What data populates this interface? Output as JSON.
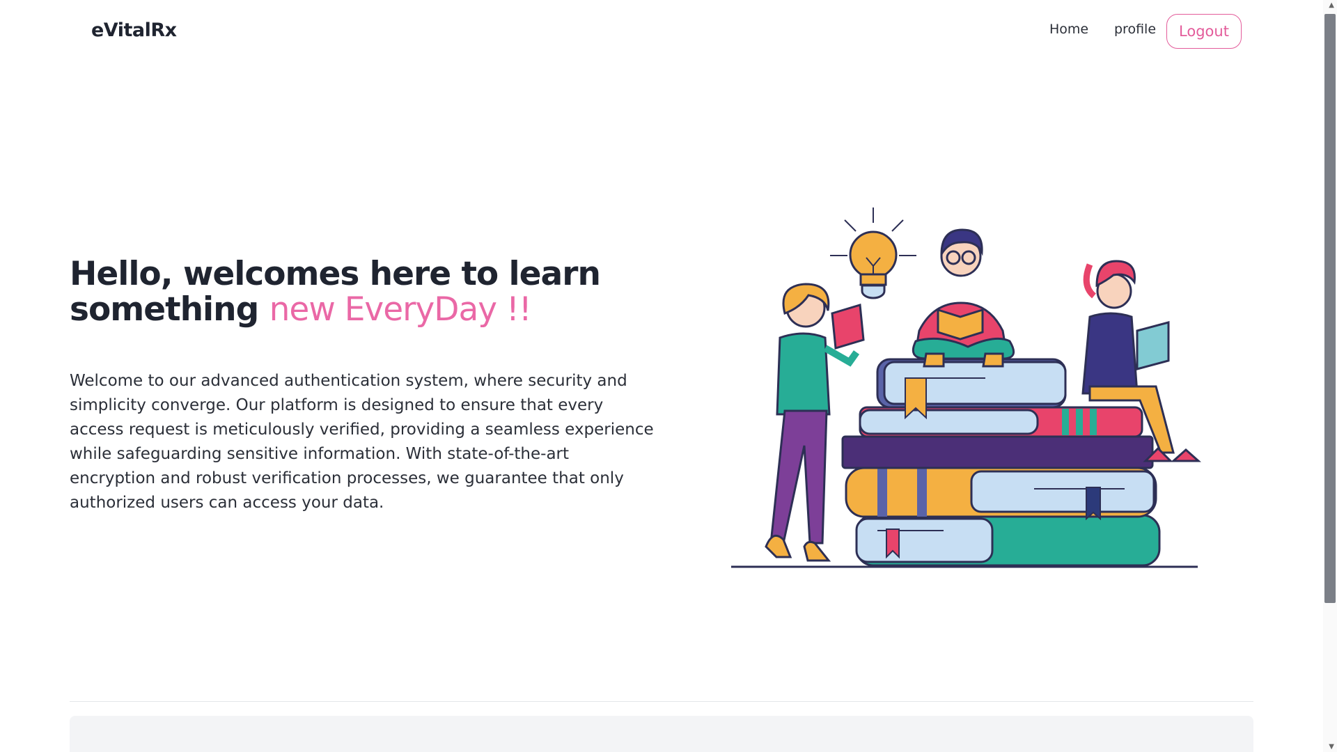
{
  "nav": {
    "brand": "eVitalRx",
    "links": [
      {
        "label": "Home"
      },
      {
        "label": "profile"
      }
    ],
    "logout_label": "Logout"
  },
  "hero": {
    "title_line1": "Hello, welcomes here to learn",
    "title_line2_prefix": "something",
    "title_accent": "new EveryDay !!",
    "description": "Welcome to our advanced authentication system, where security and simplicity converge. Our platform is designed to ensure that every access request is meticulously verified, providing a seamless experience while safeguarding sensitive information. With state-of-the-art encryption and robust verification processes, we guarantee that only authorized users can access your data."
  },
  "colors": {
    "accent": "#ea68a6",
    "text": "#1f2430"
  },
  "icons": {
    "scroll_up": "scroll-up-arrow-icon",
    "scroll_down": "scroll-down-arrow-icon"
  }
}
